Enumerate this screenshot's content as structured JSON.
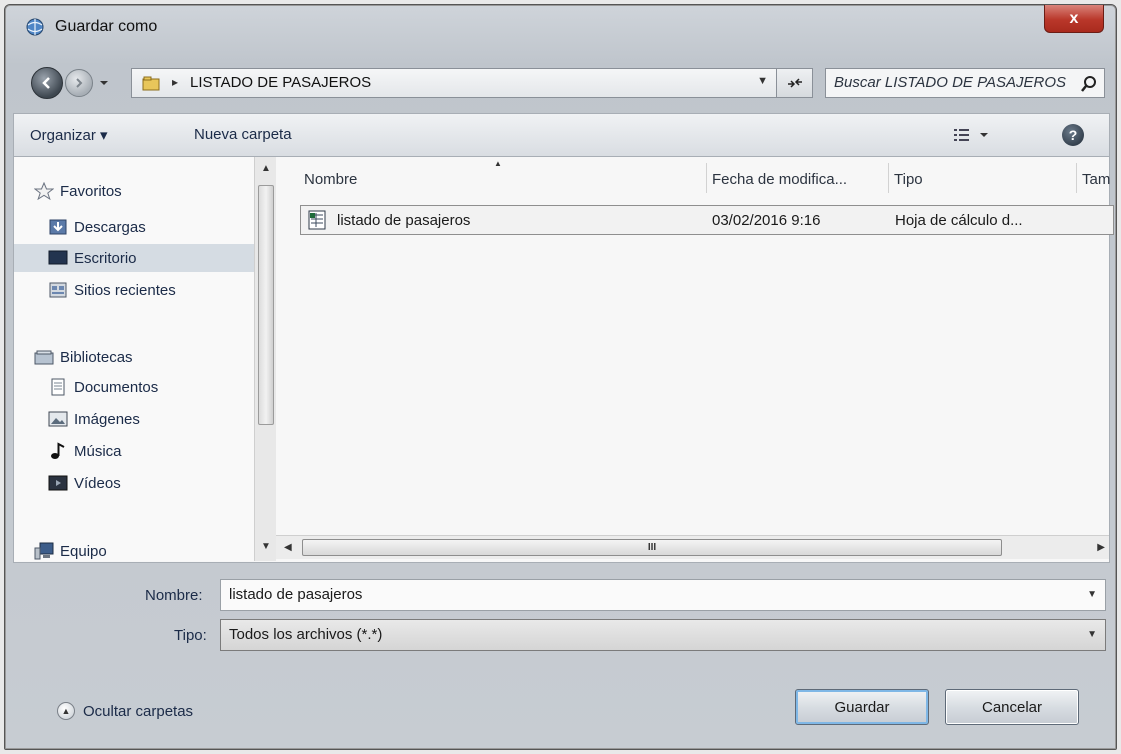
{
  "window": {
    "title": "Guardar como",
    "close_label": "x"
  },
  "address": {
    "path_segment": "LISTADO DE PASAJEROS",
    "search_placeholder": "Buscar LISTADO DE PASAJEROS"
  },
  "toolbar": {
    "organize_label": "Organizar ▾",
    "new_folder_label": "Nueva carpeta",
    "help_label": "?"
  },
  "sidebar": {
    "items": [
      {
        "label": "Favoritos",
        "icon": "star-icon"
      },
      {
        "label": "Descargas",
        "icon": "downloads-folder-icon"
      },
      {
        "label": "Escritorio",
        "icon": "desktop-icon",
        "selected": true
      },
      {
        "label": "Sitios recientes",
        "icon": "recent-places-icon"
      },
      {
        "label": "Bibliotecas",
        "icon": "libraries-icon"
      },
      {
        "label": "Documentos",
        "icon": "documents-icon"
      },
      {
        "label": "Imágenes",
        "icon": "pictures-icon"
      },
      {
        "label": "Música",
        "icon": "music-icon"
      },
      {
        "label": "Vídeos",
        "icon": "videos-icon"
      },
      {
        "label": "Equipo",
        "icon": "computer-icon"
      }
    ]
  },
  "file_list": {
    "columns": [
      "Nombre",
      "Fecha de modifica...",
      "Tipo",
      "Tam"
    ],
    "rows": [
      {
        "name": "listado de pasajeros",
        "date": "03/02/2016 9:16",
        "type": "Hoja de cálculo d..."
      }
    ]
  },
  "form": {
    "name_label": "Nombre:",
    "name_value": "listado de pasajeros",
    "type_label": "Tipo:",
    "type_value": "Todos los archivos (*.*)"
  },
  "footer": {
    "hide_folders_label": "Ocultar carpetas",
    "save_label": "Guardar",
    "cancel_label": "Cancelar"
  },
  "scrollbar": {
    "thumb_grip": "III"
  },
  "colors": {
    "close_button": "#b9372a",
    "selected_item": "#d5dce3",
    "primary_focus": "#7fb7e6"
  }
}
